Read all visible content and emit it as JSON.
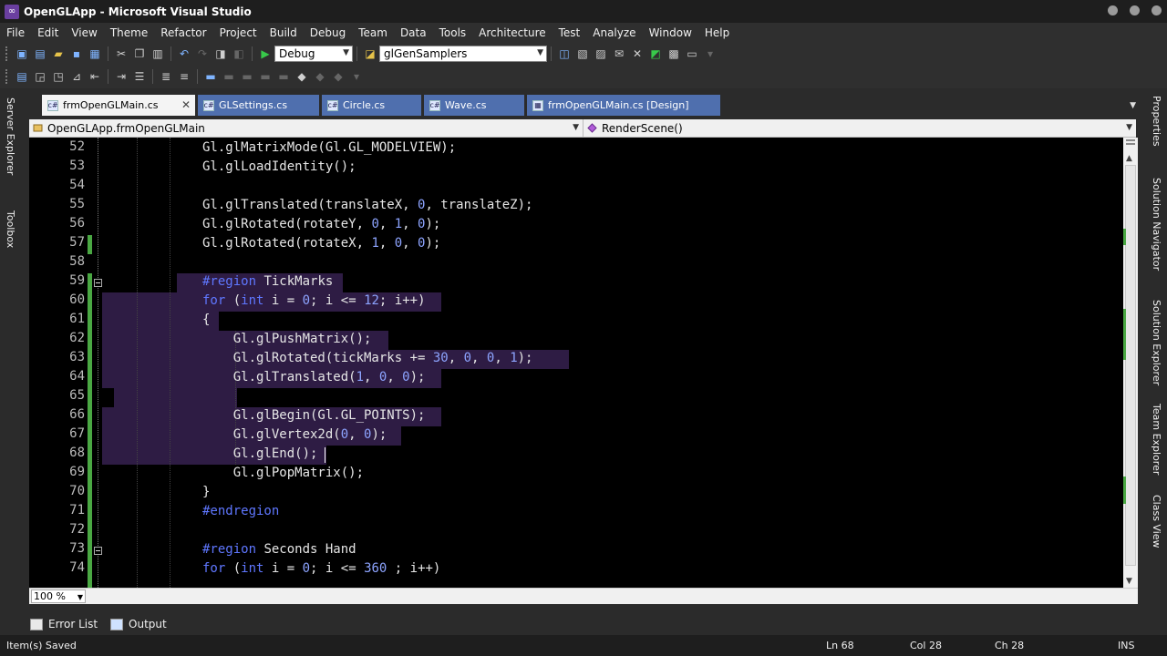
{
  "window": {
    "title": "OpenGLApp - Microsoft Visual Studio"
  },
  "menu": [
    "File",
    "Edit",
    "View",
    "Theme",
    "Refactor",
    "Project",
    "Build",
    "Debug",
    "Team",
    "Data",
    "Tools",
    "Architecture",
    "Test",
    "Analyze",
    "Window",
    "Help"
  ],
  "toolbar": {
    "config": "Debug",
    "find": "glGenSamplers"
  },
  "left_rail": {
    "server_explorer": "Server Explorer",
    "toolbox": "Toolbox"
  },
  "right_rail": {
    "properties": "Properties",
    "solution_navigator": "Solution Navigator",
    "solution_explorer": "Solution Explorer",
    "team_explorer": "Team Explorer",
    "class_view": "Class View"
  },
  "tabs": [
    {
      "label": "frmOpenGLMain.cs"
    },
    {
      "label": "GLSettings.cs"
    },
    {
      "label": "Circle.cs"
    },
    {
      "label": "Wave.cs"
    },
    {
      "label": "frmOpenGLMain.cs [Design]"
    }
  ],
  "nav": {
    "class": "OpenGLApp.frmOpenGLMain",
    "member": "RenderScene()"
  },
  "code": [
    {
      "n": "52",
      "text": "Gl.glMatrixMode(Gl.GL_MODELVIEW);"
    },
    {
      "n": "53",
      "text": "Gl.glLoadIdentity();"
    },
    {
      "n": "54",
      "text": ""
    },
    {
      "n": "55",
      "text": "Gl.glTranslated(translateX, 0, translateZ);"
    },
    {
      "n": "56",
      "text": "Gl.glRotated(rotateY, 0, 1, 0);"
    },
    {
      "n": "57",
      "text": "Gl.glRotated(rotateX, 1, 0, 0);"
    },
    {
      "n": "58",
      "text": ""
    },
    {
      "n": "59",
      "text": "#region TickMarks"
    },
    {
      "n": "60",
      "text": "for (int i = 0; i <= 12; i++)"
    },
    {
      "n": "61",
      "text": "{"
    },
    {
      "n": "62",
      "text": "    Gl.glPushMatrix();"
    },
    {
      "n": "63",
      "text": "    Gl.glRotated(tickMarks += 30, 0, 0, 1);"
    },
    {
      "n": "64",
      "text": "    Gl.glTranslated(1, 0, 0);"
    },
    {
      "n": "65",
      "text": ""
    },
    {
      "n": "66",
      "text": "    Gl.glBegin(Gl.GL_POINTS);"
    },
    {
      "n": "67",
      "text": "    Gl.glVertex2d(0, 0);"
    },
    {
      "n": "68",
      "text": "    Gl.glEnd();"
    },
    {
      "n": "69",
      "text": "    Gl.glPopMatrix();"
    },
    {
      "n": "70",
      "text": "}"
    },
    {
      "n": "71",
      "text": "#endregion"
    },
    {
      "n": "72",
      "text": ""
    },
    {
      "n": "73",
      "text": "#region Seconds Hand"
    },
    {
      "n": "74",
      "text": "for (int i = 0; i <= 360 ; i++)"
    }
  ],
  "editor": {
    "zoom": "100 %"
  },
  "bottom_tabs": {
    "error_list": "Error List",
    "output": "Output"
  },
  "status": {
    "message": "Item(s) Saved",
    "ln": "Ln 68",
    "col": "Col 28",
    "ch": "Ch 28",
    "mode": "INS"
  }
}
